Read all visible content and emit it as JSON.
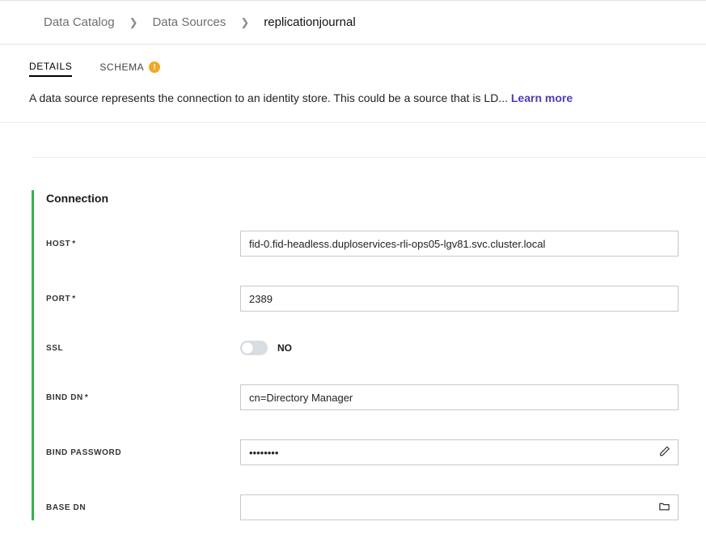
{
  "breadcrumb": {
    "items": [
      {
        "label": "Data Catalog"
      },
      {
        "label": "Data Sources"
      },
      {
        "label": "replicationjournal"
      }
    ]
  },
  "tabs": {
    "details": "DETAILS",
    "schema": "SCHEMA",
    "schemaWarn": "!"
  },
  "description": {
    "text": "A data source represents the connection to an identity store. This could be a source that is LD... ",
    "learnMore": "Learn more"
  },
  "section": {
    "title": "Connection",
    "fields": {
      "host": {
        "label": "HOST",
        "required": "*",
        "value": "fid-0.fid-headless.duploservices-rli-ops05-lgv81.svc.cluster.local"
      },
      "port": {
        "label": "PORT",
        "required": "*",
        "value": "2389"
      },
      "ssl": {
        "label": "SSL",
        "state": "NO"
      },
      "bindDn": {
        "label": "BIND DN",
        "required": "*",
        "value": "cn=Directory Manager"
      },
      "bindPassword": {
        "label": "BIND PASSWORD",
        "value": "••••••••"
      },
      "baseDn": {
        "label": "BASE DN",
        "value": ""
      }
    }
  }
}
